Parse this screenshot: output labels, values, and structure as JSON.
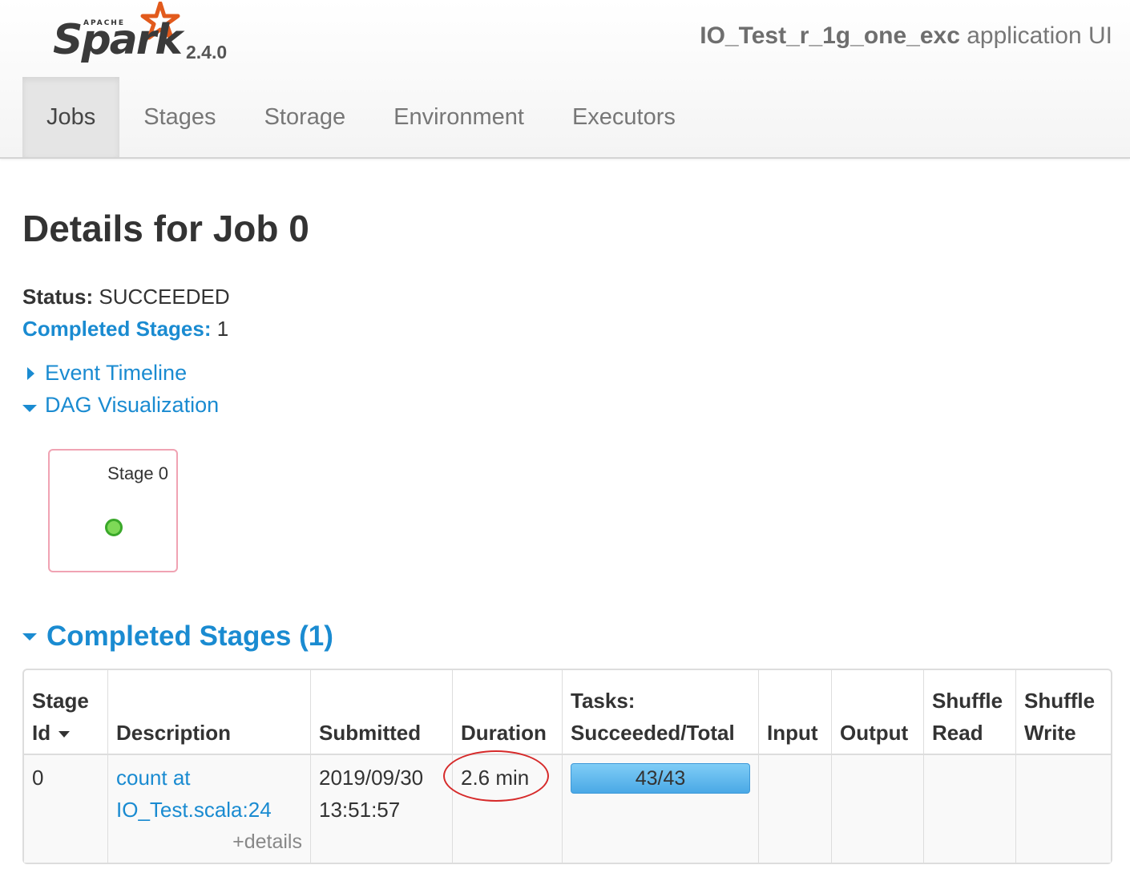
{
  "header": {
    "brand_apache": "APACHE",
    "brand_name": "Spark",
    "version": "2.4.0",
    "app_name": "IO_Test_r_1g_one_exc",
    "app_suffix": " application UI"
  },
  "nav": {
    "tabs": [
      {
        "label": "Jobs",
        "active": true
      },
      {
        "label": "Stages",
        "active": false
      },
      {
        "label": "Storage",
        "active": false
      },
      {
        "label": "Environment",
        "active": false
      },
      {
        "label": "Executors",
        "active": false
      }
    ]
  },
  "page": {
    "title": "Details for Job 0",
    "status_label": "Status:",
    "status_value": "SUCCEEDED",
    "completed_label": "Completed Stages:",
    "completed_value": "1",
    "event_timeline": "Event Timeline",
    "dag_visualization": "DAG Visualization",
    "dag_stage_label": "Stage 0",
    "dag_node_color": "#7ed957"
  },
  "completed_section": {
    "title": "Completed Stages (1)"
  },
  "table": {
    "headers": {
      "stage_id_line1": "Stage",
      "stage_id_line2": "Id",
      "description": "Description",
      "submitted": "Submitted",
      "duration": "Duration",
      "tasks_line1": "Tasks:",
      "tasks_line2": "Succeeded/Total",
      "input": "Input",
      "output": "Output",
      "shuffle_read_line1": "Shuffle",
      "shuffle_read_line2": "Read",
      "shuffle_write_line1": "Shuffle",
      "shuffle_write_line2": "Write"
    },
    "rows": [
      {
        "stage_id": "0",
        "description_line1": "count at",
        "description_line2": "IO_Test.scala:24",
        "details": "+details",
        "submitted_line1": "2019/09/30",
        "submitted_line2": "13:51:57",
        "duration": "2.6 min",
        "tasks": "43/43",
        "tasks_progress": 1.0,
        "input": "",
        "output": "",
        "shuffle_read": "",
        "shuffle_write": ""
      }
    ]
  },
  "colors": {
    "link": "#1a8bd1",
    "annotation_ring": "#d62a2a",
    "progress": "#4aa9e6"
  }
}
